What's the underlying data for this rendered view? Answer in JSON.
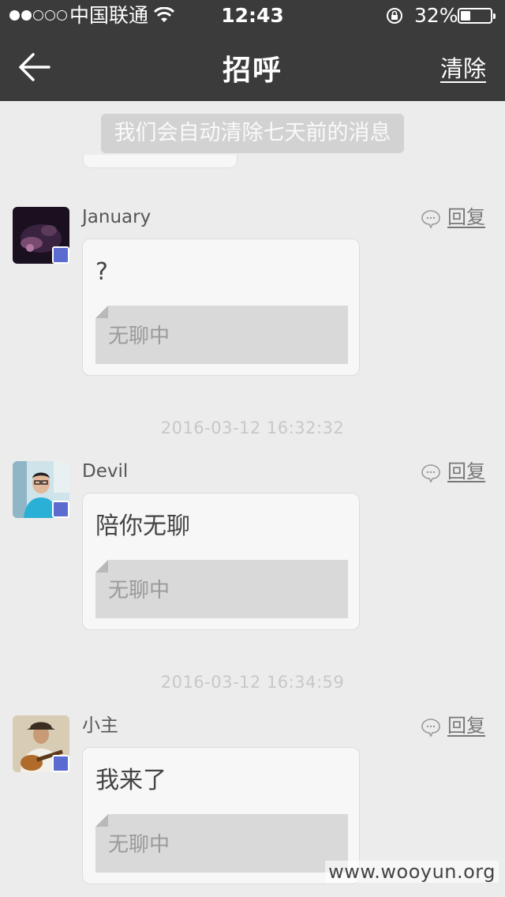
{
  "status_bar": {
    "carrier": "中国联通",
    "time": "12:43",
    "battery_percent": "32%",
    "battery_level": 0.32,
    "signal_bars_filled": 2,
    "signal_bars_total": 5
  },
  "nav": {
    "title": "招呼",
    "clear_label": "清除",
    "back_icon": "arrow-left-icon"
  },
  "notice": "我们会自动清除七天前的消息",
  "messages": [
    {
      "username": "January",
      "reply_label": "回复",
      "text": "?",
      "quote": "无聊中",
      "avatar_color": "#2a1830"
    },
    {
      "timestamp": "2016-03-12 16:32:32",
      "username": "Devil",
      "reply_label": "回复",
      "text": "陪你无聊",
      "quote": "无聊中",
      "avatar_color": "#6fb0c8"
    },
    {
      "timestamp": "2016-03-12 16:34:59",
      "username": "小主",
      "reply_label": "回复",
      "text": "我来了",
      "quote": "无聊中",
      "avatar_color": "#c9b89a"
    }
  ],
  "watermark": "www.wooyun.org",
  "colors": {
    "nav_background": "#3b3b3b",
    "page_background": "#ececec",
    "badge": "#5b6bd0"
  }
}
